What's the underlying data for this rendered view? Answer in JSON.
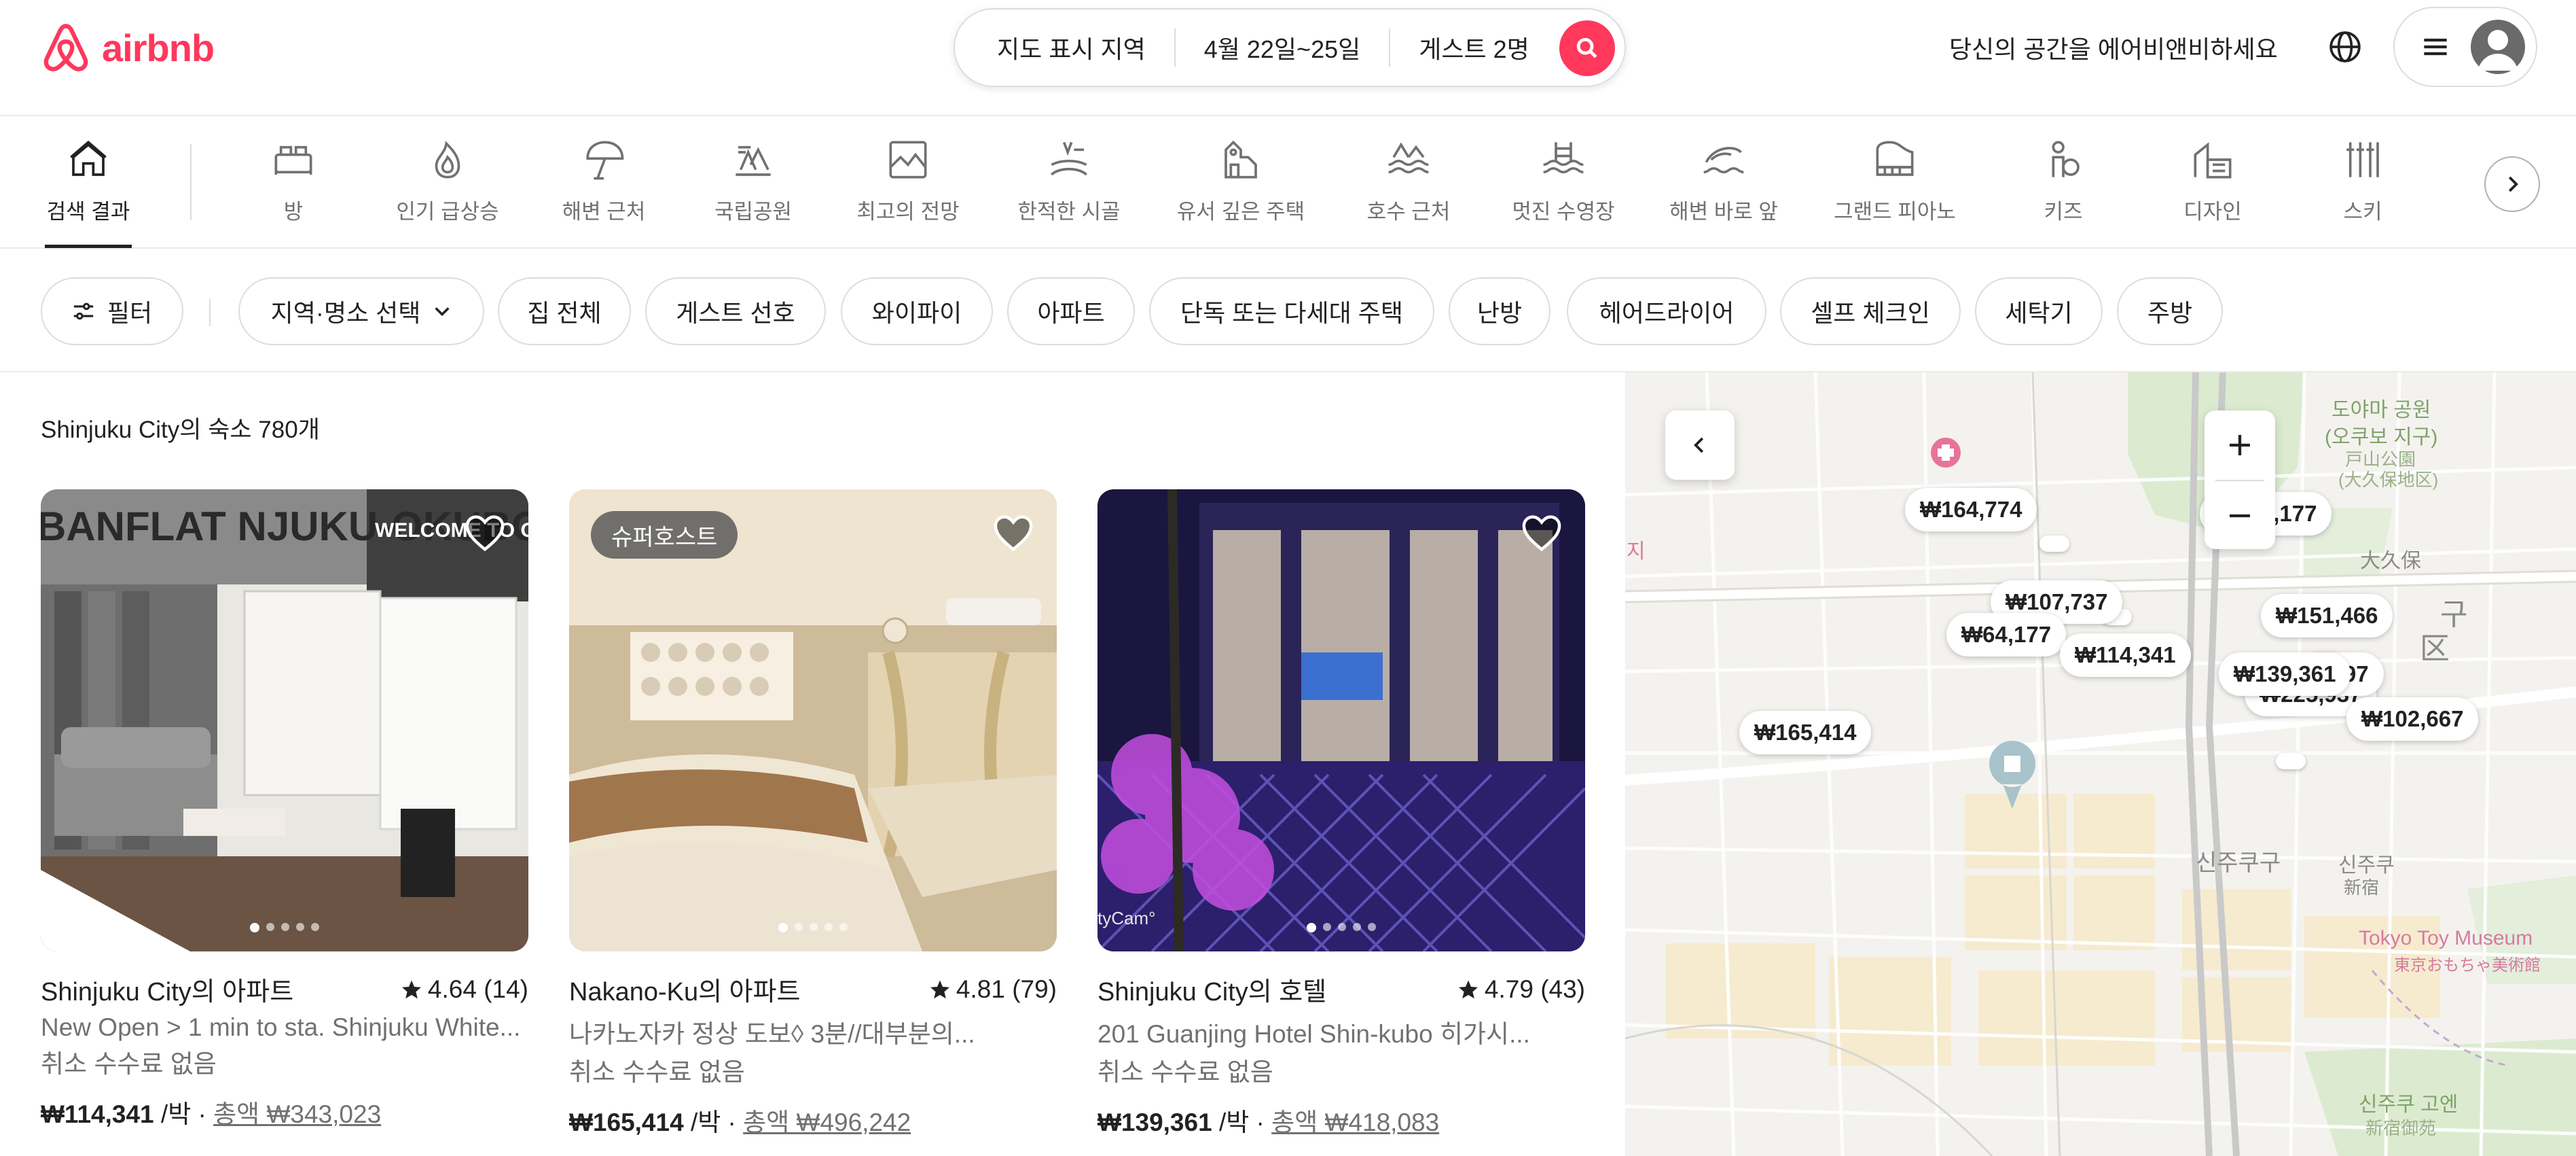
{
  "header": {
    "logo_text": "airbnb",
    "search": {
      "location": "지도 표시 지역",
      "dates": "4월 22일~25일",
      "guests": "게스트 2명"
    },
    "host_link": "당신의 공간을 에어비앤비하세요"
  },
  "categories": [
    {
      "label": "검색 결과",
      "icon": "search-results-icon",
      "active": true
    },
    {
      "label": "방",
      "icon": "room-icon"
    },
    {
      "label": "인기 급상승",
      "icon": "trending-fire-icon"
    },
    {
      "label": "해변 근처",
      "icon": "beach-umbrella-icon"
    },
    {
      "label": "국립공원",
      "icon": "national-park-icon"
    },
    {
      "label": "최고의 전망",
      "icon": "view-icon"
    },
    {
      "label": "한적한 시골",
      "icon": "countryside-icon"
    },
    {
      "label": "유서 깊은 주택",
      "icon": "historic-home-icon"
    },
    {
      "label": "호수 근처",
      "icon": "lake-icon"
    },
    {
      "label": "멋진 수영장",
      "icon": "pool-icon"
    },
    {
      "label": "해변 바로 앞",
      "icon": "beachfront-icon"
    },
    {
      "label": "그랜드 피아노",
      "icon": "piano-icon"
    },
    {
      "label": "키즈",
      "icon": "kids-icon"
    },
    {
      "label": "디자인",
      "icon": "design-icon"
    },
    {
      "label": "스키",
      "icon": "ski-icon"
    }
  ],
  "filters": {
    "filter_button": "필터",
    "chips": [
      "지역·명소 선택",
      "집 전체",
      "게스트 선호",
      "와이파이",
      "아파트",
      "단독 또는 다세대 주택",
      "난방",
      "헤어드라이어",
      "셀프 체크인",
      "세탁기",
      "주방"
    ]
  },
  "results": {
    "count_text": "Shinjuku City의 숙소 780개",
    "listings": [
      {
        "title": "Shinjuku City의 아파트",
        "rating": "4.64 (14)",
        "subtitle": "New Open > 1 min to sta. Shinjuku White...",
        "cancellation": "취소 수수료 없음",
        "price": "₩114,341",
        "per_night": " /박 · ",
        "total": "총액 ₩343,023",
        "photo_text": "BANFLAT NJUKU-OKUBO",
        "photo_sign": "WELCOME TO OUR LOVELY"
      },
      {
        "title": "Nakano-Ku의 아파트",
        "rating": "4.81 (79)",
        "subtitle": "나카노자카 정상 도보◊ 3분//대부분의...",
        "cancellation": "취소 수수료 없음",
        "price": "₩165,414",
        "per_night": " /박 · ",
        "total": "총액 ₩496,242",
        "badge": "슈퍼호스트"
      },
      {
        "title": "Shinjuku City의 호텔",
        "rating": "4.79 (43)",
        "subtitle": "201 Guanjing Hotel Shin-kubo 히가시...",
        "cancellation": "취소 수수료 없음",
        "price": "₩139,361",
        "per_night": " /박 · ",
        "total": "총액 ₩418,083",
        "photo_text": "tyCam°"
      }
    ]
  },
  "map": {
    "pins": [
      "₩164,774",
      "₩136,177",
      "₩107,737",
      "₩64,177",
      "₩114,341",
      "₩151,466",
      "₩139,361",
      "2,697",
      "₩225,937",
      "₩102,667",
      "₩165,414"
    ],
    "labels": {
      "toyama_park": "도야마 공원",
      "okubo_district": "(오쿠보 지구)",
      "toyama_jp": "戸山公園",
      "okubo_jp": "(大久保地区)",
      "okubo_kr": "大久保",
      "ward_partial": "구",
      "ward_partial2": "区",
      "shinjuku_gu": "신주쿠구",
      "shinjuku_kr": "신주쿠",
      "shinjuku_jp": "新宿",
      "toy_museum": "Tokyo Toy Museum",
      "toy_museum_jp": "東京おもちゃ美術館",
      "high_school": "신주쿠 고엔",
      "high_school_jp": "新宿御苑",
      "left_edge": "지"
    }
  },
  "colors": {
    "brand": "#ff385c",
    "text": "#222222",
    "muted": "#717171",
    "border": "#dddddd"
  }
}
